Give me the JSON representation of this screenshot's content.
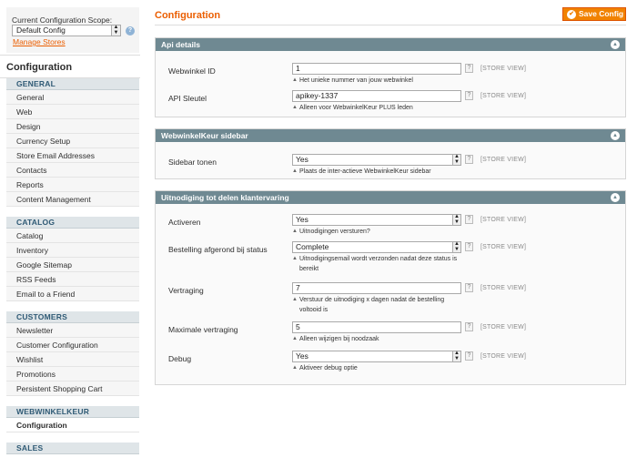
{
  "sidebar": {
    "scope_label": "Current Configuration Scope:",
    "scope_value": "Default Config",
    "manage_stores": "Manage Stores",
    "title": "Configuration",
    "sections": [
      {
        "heading": "GENERAL",
        "items": [
          "General",
          "Web",
          "Design",
          "Currency Setup",
          "Store Email Addresses",
          "Contacts",
          "Reports",
          "Content Management"
        ]
      },
      {
        "heading": "CATALOG",
        "items": [
          "Catalog",
          "Inventory",
          "Google Sitemap",
          "RSS Feeds",
          "Email to a Friend"
        ]
      },
      {
        "heading": "CUSTOMERS",
        "items": [
          "Newsletter",
          "Customer Configuration",
          "Wishlist",
          "Promotions",
          "Persistent Shopping Cart"
        ]
      },
      {
        "heading": "WEBWINKELKEUR",
        "items": [
          "Configuration"
        ]
      },
      {
        "heading": "SALES",
        "items": []
      }
    ]
  },
  "header": {
    "title": "Configuration",
    "save_label": "Save Config"
  },
  "fieldsets": [
    {
      "title": "Api details",
      "rows": [
        {
          "label": "Webwinkel ID",
          "kind": "input",
          "value": "1",
          "scope": "[STORE VIEW]",
          "note": "Het unieke nummer van jouw webwinkel"
        },
        {
          "label": "API Sleutel",
          "kind": "input",
          "value": "apikey-1337",
          "scope": "[STORE VIEW]",
          "note": "Alleen voor WebwinkelKeur PLUS leden"
        }
      ]
    },
    {
      "title": "WebwinkelKeur sidebar",
      "rows": [
        {
          "label": "Sidebar tonen",
          "kind": "select",
          "value": "Yes",
          "scope": "[STORE VIEW]",
          "note": "Plaats de inter-actieve WebwinkelKeur sidebar"
        }
      ]
    },
    {
      "title": "Uitnodiging tot delen klantervaring",
      "rows": [
        {
          "label": "Activeren",
          "kind": "select",
          "value": "Yes",
          "scope": "[STORE VIEW]",
          "note": "Uitnodigingen versturen?"
        },
        {
          "label": "Bestelling afgerond bij status",
          "kind": "select",
          "value": "Complete",
          "scope": "[STORE VIEW]",
          "note": "Uitnodigingsemail wordt verzonden nadat deze status is bereikt"
        },
        {
          "label": "Vertraging",
          "kind": "input",
          "value": "7",
          "scope": "[STORE VIEW]",
          "note": "Verstuur de uitnodiging x dagen nadat de bestelling voltooid is"
        },
        {
          "label": "Maximale vertraging",
          "kind": "input",
          "value": "5",
          "scope": "[STORE VIEW]",
          "note": "Alleen wijzigen bij noodzaak"
        },
        {
          "label": "Debug",
          "kind": "select",
          "value": "Yes",
          "scope": "[STORE VIEW]",
          "note": "Aktiveer debug optie"
        }
      ]
    }
  ]
}
